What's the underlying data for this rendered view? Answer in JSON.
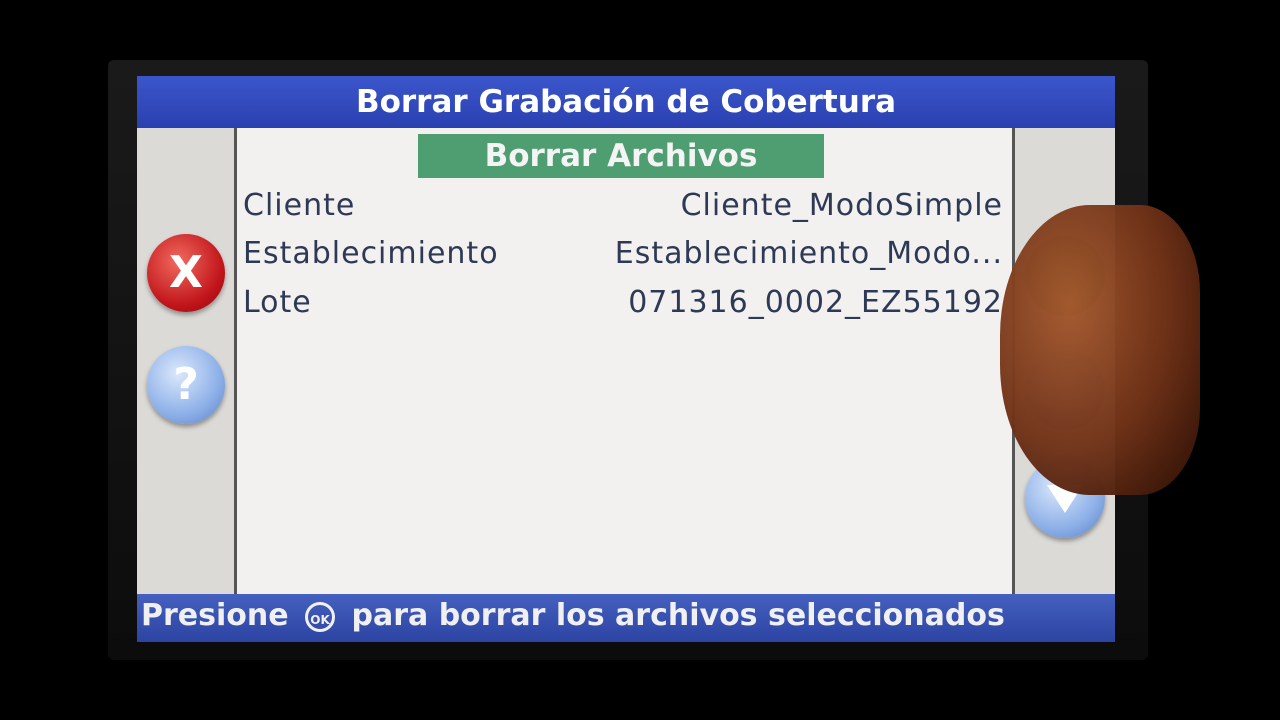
{
  "title": "Borrar Grabación de Cobertura",
  "subheader": "Borrar Archivos",
  "rows": [
    {
      "label": "Cliente",
      "value": "Cliente_ModoSimple"
    },
    {
      "label": "Establecimiento",
      "value": "Establecimiento_Modo..."
    },
    {
      "label": "Lote",
      "value": "071316_0002_EZ55192"
    }
  ],
  "buttons": {
    "cancel_glyph": "X",
    "help_glyph": "?"
  },
  "status": {
    "prefix": "Presione",
    "ok_label": "OK",
    "suffix": "para borrar los archivos seleccionados"
  },
  "icons": {
    "cancel": "close-icon",
    "help": "help-icon",
    "confirm": "confirm-icon",
    "scroll_up": "arrow-up-icon",
    "scroll_down": "arrow-down-icon",
    "ok": "ok-icon"
  },
  "colors": {
    "titlebar": "#2f48bb",
    "subheader": "#4f9e72",
    "cancel_button": "#c0141a",
    "help_button": "#8db0e8",
    "confirm_button": "#5aa64a"
  }
}
